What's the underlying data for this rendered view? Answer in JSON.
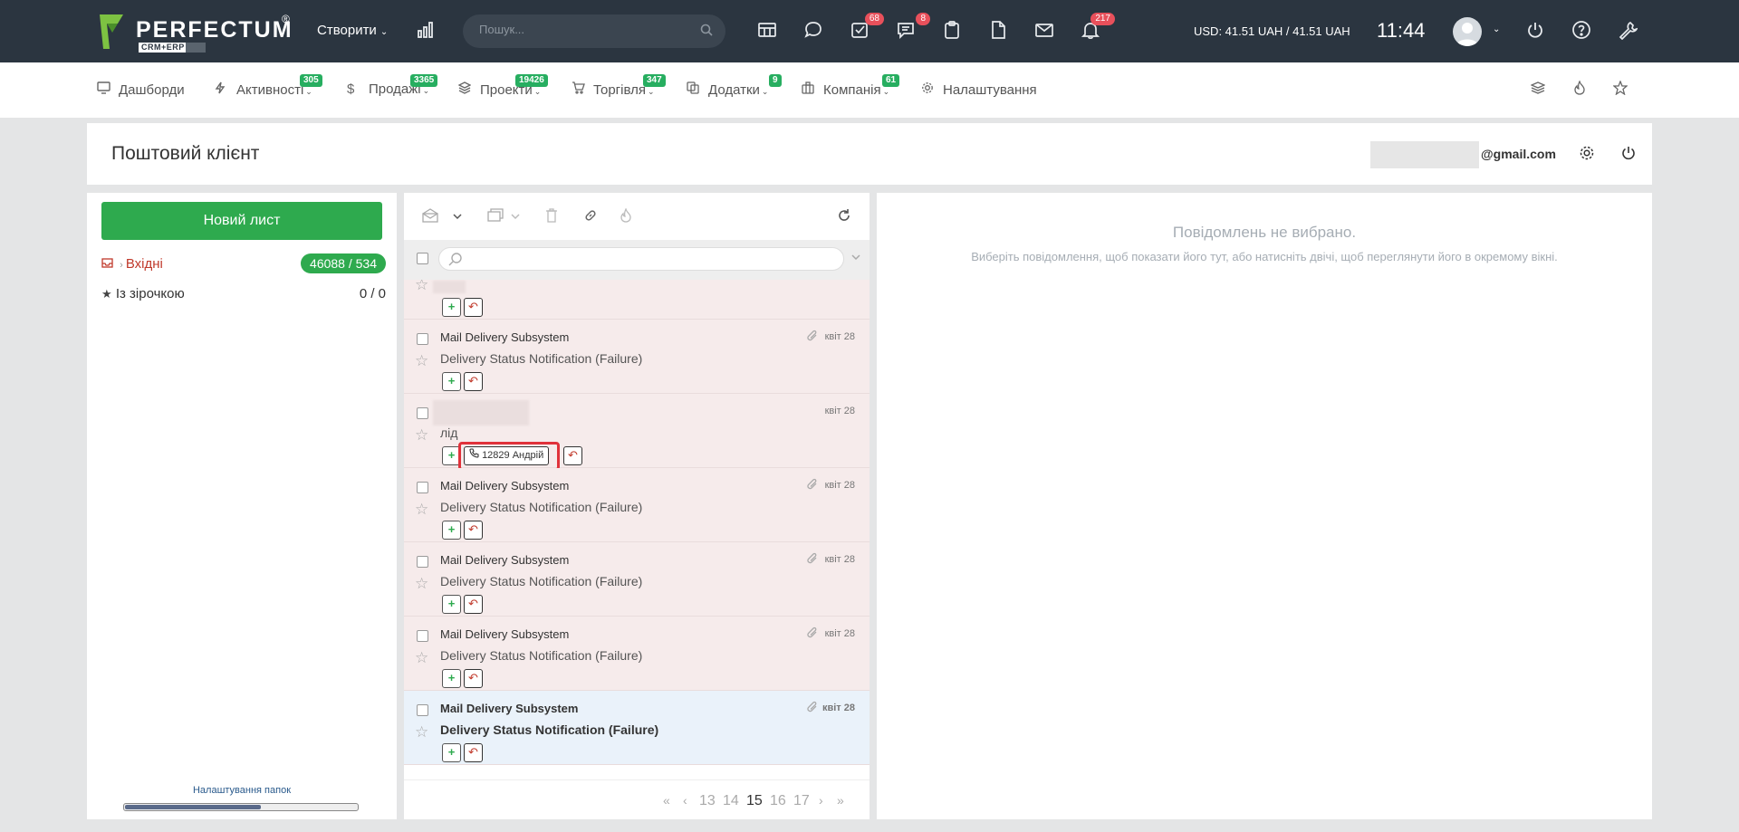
{
  "topbar": {
    "logo_text": "PERFECTUM",
    "logo_reg": "®",
    "logo_sub": "CRM+ERP",
    "create_label": "Створити",
    "search_placeholder": "Пошук...",
    "badges": {
      "tasks": "68",
      "chat": "8",
      "notifications": "217"
    },
    "currency": "USD: 41.51 UAH / 41.51 UAH",
    "time": "11:44"
  },
  "nav": {
    "items": [
      {
        "label": "Дашборди",
        "badge": "",
        "icon": "monitor-icon"
      },
      {
        "label": "Активності",
        "badge": "305",
        "icon": "lightning-icon"
      },
      {
        "label": "Продажі",
        "badge": "3365",
        "icon": "dollar-icon"
      },
      {
        "label": "Проекти",
        "badge": "19426",
        "icon": "layers-icon"
      },
      {
        "label": "Торгівля",
        "badge": "347",
        "icon": "cart-icon"
      },
      {
        "label": "Додатки",
        "badge": "9",
        "icon": "copy-icon"
      },
      {
        "label": "Компанія",
        "badge": "61",
        "icon": "briefcase-icon"
      },
      {
        "label": "Налаштування",
        "badge": "",
        "icon": "gear-icon"
      }
    ]
  },
  "page": {
    "title": "Поштовий клієнт",
    "email_domain": "@gmail.com"
  },
  "folders": {
    "new_mail_label": "Новий лист",
    "items": [
      {
        "label": "Вхідні",
        "count": "46088 / 534"
      },
      {
        "label": "Із зірочкою",
        "count": "0 / 0"
      }
    ],
    "settings_label": "Налаштування папок"
  },
  "messages": [
    {
      "sender": "",
      "subject": "",
      "date": "",
      "attachment": false,
      "lead": ""
    },
    {
      "sender": "Mail Delivery Subsystem",
      "subject": "Delivery Status Notification (Failure)",
      "date": "квіт 28",
      "attachment": true,
      "lead": ""
    },
    {
      "sender": "",
      "subject": "лід",
      "date": "квіт 28",
      "attachment": false,
      "lead": "12829 Андрій"
    },
    {
      "sender": "Mail Delivery Subsystem",
      "subject": "Delivery Status Notification (Failure)",
      "date": "квіт 28",
      "attachment": true,
      "lead": ""
    },
    {
      "sender": "Mail Delivery Subsystem",
      "subject": "Delivery Status Notification (Failure)",
      "date": "квіт 28",
      "attachment": true,
      "lead": ""
    },
    {
      "sender": "Mail Delivery Subsystem",
      "subject": "Delivery Status Notification (Failure)",
      "date": "квіт 28",
      "attachment": true,
      "lead": ""
    },
    {
      "sender": "Mail Delivery Subsystem",
      "subject": "Delivery Status Notification (Failure)",
      "date": "квіт 28",
      "attachment": true,
      "lead": ""
    }
  ],
  "pager": {
    "pages": [
      "13",
      "14",
      "15",
      "16",
      "17"
    ],
    "current": "15"
  },
  "detail": {
    "empty_title": "Повідомлень не вибрано.",
    "empty_hint": "Виберіть повідомлення, щоб показати його тут, або натисніть двічі, щоб переглянути його в окремому вікні."
  },
  "colors": {
    "topbar": "#2b3540",
    "accent_green": "#2eaa4e",
    "badge_red": "#e8505b",
    "unread_row": "#f6ebeb",
    "selected_row": "#eaf2fa",
    "highlight": "#e0323b"
  }
}
